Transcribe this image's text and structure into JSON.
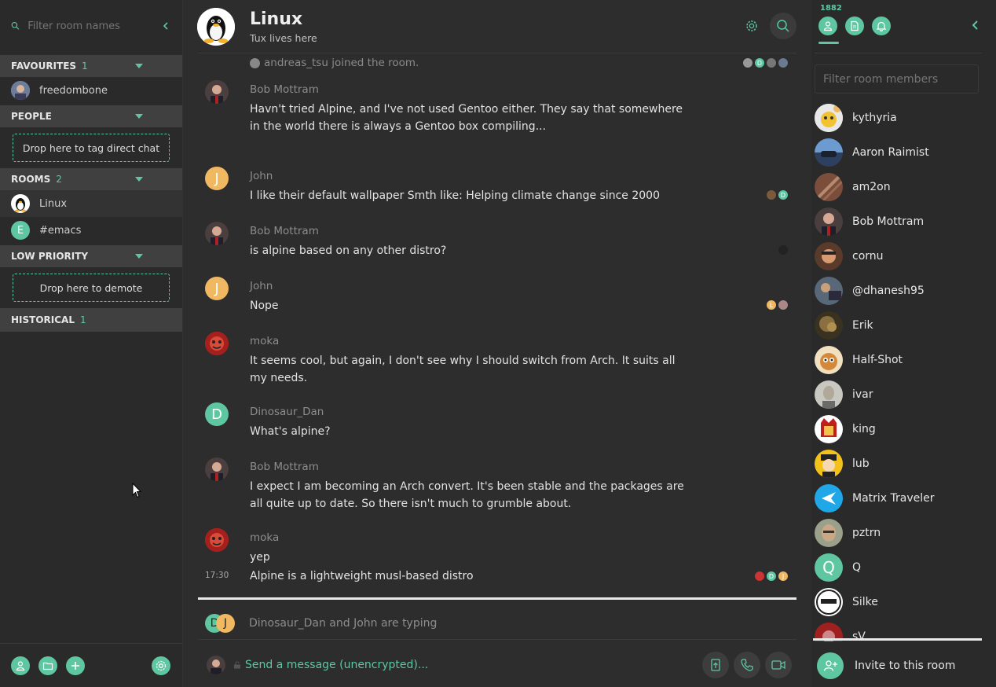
{
  "left": {
    "filter_placeholder": "Filter room names",
    "sections": {
      "favourites": {
        "title": "FAVOURITES",
        "count": "1"
      },
      "people": {
        "title": "PEOPLE"
      },
      "rooms": {
        "title": "ROOMS",
        "count": "2"
      },
      "low_priority": {
        "title": "LOW PRIORITY"
      },
      "historical": {
        "title": "HISTORICAL",
        "count": "1"
      }
    },
    "favourite_rooms": [
      "freedombone"
    ],
    "rooms": [
      {
        "name": "Linux",
        "letter": ""
      },
      {
        "name": "#emacs",
        "letter": "E"
      }
    ],
    "drop_tag_direct": "Drop here to tag direct chat",
    "drop_demote": "Drop here to demote"
  },
  "room": {
    "name": "Linux",
    "topic": "Tux lives here"
  },
  "timeline": {
    "join_notice": "andreas_tsu joined the room.",
    "events": [
      {
        "sender": "Bob Mottram",
        "body": "Havn't tried Alpine, and I've not used Gentoo either. They say that somewhere in the world there is always a Gentoo box compiling..."
      },
      {
        "sender": "John",
        "letter": "J",
        "body": "I like their default wallpaper Smth like: Helping climate change since 2000"
      },
      {
        "sender": "Bob Mottram",
        "body": "is alpine based on any other distro?"
      },
      {
        "sender": "John",
        "letter": "J",
        "body": "Nope"
      },
      {
        "sender": "moka",
        "body": "It seems cool, but again, I don't see why I should switch from Arch. It suits all my needs."
      },
      {
        "sender": "Dinosaur_Dan",
        "letter": "D",
        "body": "What's alpine?"
      },
      {
        "sender": "Bob Mottram",
        "body": "I expect I am becoming an Arch convert. It's been stable and the packages are all quite up to date. So there isn't much to grumble about."
      },
      {
        "sender": "moka",
        "body": "yep"
      }
    ],
    "continuation": {
      "time": "17:30",
      "body": "Alpine is a lightweight musl-based distro"
    },
    "receipt_letters": {
      "d": "D",
      "j": "J",
      "l": "L"
    }
  },
  "typing": {
    "text": "Dinosaur_Dan and John are typing",
    "letters": [
      "D",
      "J"
    ]
  },
  "composer": {
    "placeholder": "Send a message (unencrypted)..."
  },
  "right": {
    "member_count": "1882",
    "filter_placeholder": "Filter room members",
    "members": [
      {
        "name": "kythyria"
      },
      {
        "name": "Aaron Raimist"
      },
      {
        "name": "am2on"
      },
      {
        "name": "Bob Mottram"
      },
      {
        "name": "cornu"
      },
      {
        "name": "@dhanesh95"
      },
      {
        "name": "Erik"
      },
      {
        "name": "Half-Shot"
      },
      {
        "name": "ivar"
      },
      {
        "name": "king"
      },
      {
        "name": "lub"
      },
      {
        "name": "Matrix Traveler"
      },
      {
        "name": "pztrn"
      },
      {
        "name": "Q",
        "letter": "Q"
      },
      {
        "name": "Silke"
      },
      {
        "name": "sV"
      }
    ],
    "invite_label": "Invite to this room"
  },
  "colors": {
    "accent": "#5ec7a2",
    "background": "#2d2d2d",
    "panel": "#2a2a2a",
    "section": "#404040",
    "john": "#f0b860"
  }
}
